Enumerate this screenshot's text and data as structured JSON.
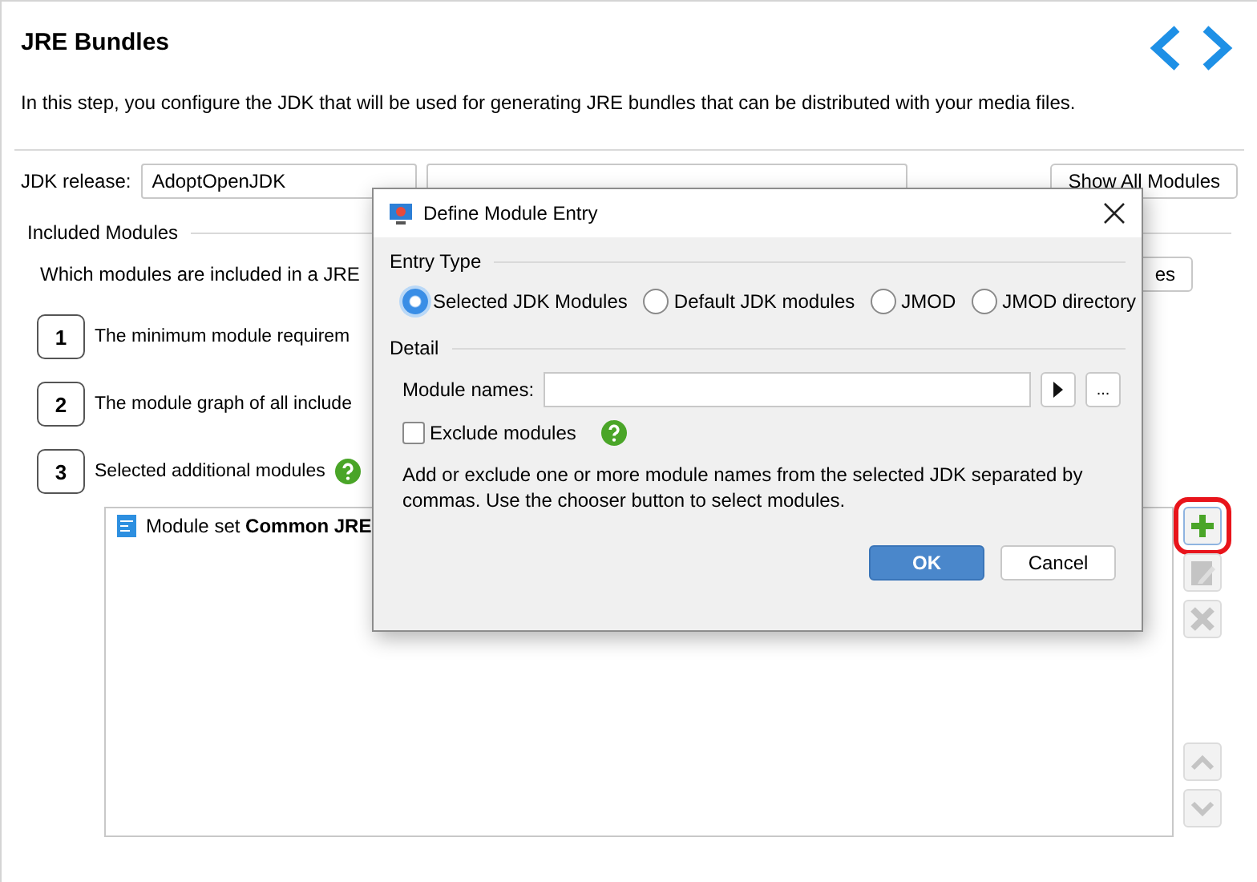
{
  "header": {
    "title": "JRE Bundles",
    "description": "In this step, you configure the JDK that will be used for generating JRE bundles that can be distributed with your media files."
  },
  "jdk": {
    "label": "JDK release:",
    "vendor": "AdoptOpenJDK",
    "show_all_button": "Show All Modules"
  },
  "included": {
    "title": "Included Modules",
    "question": "Which modules are included in a JRE",
    "question_button": "es",
    "steps": [
      {
        "number": "1",
        "text": "The minimum module requirem"
      },
      {
        "number": "2",
        "text": "The module graph of all include"
      },
      {
        "number": "3",
        "text": "Selected additional modules",
        "help": true
      }
    ]
  },
  "module_list": [
    "Module set **Common JRE**"
  ],
  "side_buttons": [
    {
      "kind": "add",
      "disabled": false,
      "highlighted": true
    },
    {
      "kind": "edit",
      "disabled": true,
      "highlighted": false
    },
    {
      "kind": "delete",
      "disabled": true,
      "highlighted": false
    },
    {
      "kind": "up",
      "disabled": true,
      "highlighted": false
    },
    {
      "kind": "down",
      "disabled": true,
      "highlighted": false
    }
  ],
  "dialog": {
    "title": "Define Module Entry",
    "entry_type_label": "Entry Type",
    "options": [
      {
        "label": "Selected JDK Modules",
        "selected": true
      },
      {
        "label": "Default JDK modules",
        "selected": false
      },
      {
        "label": "JMOD",
        "selected": false
      },
      {
        "label": "JMOD directory",
        "selected": false
      }
    ],
    "detail_label": "Detail",
    "module_names_label": "Module names:",
    "chooser_button": "...",
    "exclude": {
      "label": "Exclude modules",
      "checked": false
    },
    "hint": "Add or exclude one or more module names from the selected JDK separated by commas. Use the chooser button to select modules.",
    "ok": "OK",
    "cancel": "Cancel"
  }
}
